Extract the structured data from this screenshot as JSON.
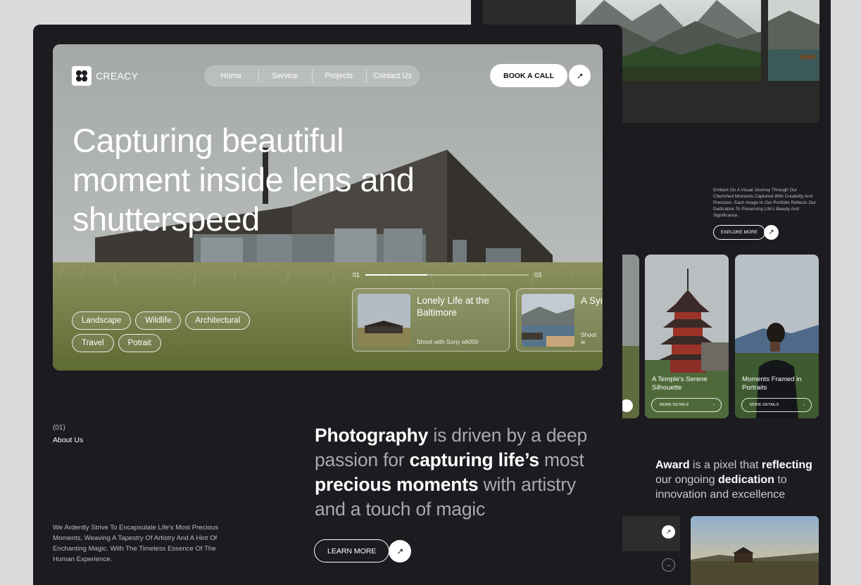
{
  "brand": {
    "name": "CREACY"
  },
  "nav": {
    "items": [
      "Home",
      "Service",
      "Projects",
      "Contact Us"
    ]
  },
  "cta": {
    "book_label": "BOOK A CALL",
    "arrow": "↗"
  },
  "hero": {
    "headline_lines": [
      "Capturing beautiful",
      "moment inside lens and",
      "shutterspeed"
    ],
    "tags": [
      "Landscape",
      "Wildlife",
      "Architectural",
      "Travel",
      "Potrait"
    ],
    "progress": {
      "start": "01",
      "end": "03",
      "fraction": 0.38
    },
    "slides": [
      {
        "title": "Lonely Life at the Baltimore",
        "subtitle": "Shoot with Sony a6000"
      },
      {
        "title": "A Syr Seas",
        "subtitle": "Shoot w"
      }
    ]
  },
  "about": {
    "number": "(01)",
    "label": "About Us",
    "blurb": "We Ardently Strive To Encapsulate Life's Most Precious Moments, Weaving A Tapestry Of Artistry And A Hint Of Enchanting Magic. With The Timeless Essence Of The Human Experience.",
    "statement": {
      "p1": "Photography",
      "p2": " is driven by a deep passion for ",
      "p3": "capturing life’s",
      "p4": " most ",
      "p5": "precious moments",
      "p6": " with artistry and a touch of magic"
    },
    "learn_more": "LEARN MORE"
  },
  "back": {
    "description": "Embark On A Visual Journey Through Our Cherished Moments Captured With Creativity And Precision. Each Image In Our Portfolio Reflects Our Dedication To Preserving Life's Beauty And Significance.",
    "explore": "EXPLORE MORE",
    "tiles": [
      {
        "caption": "A Temple's Serene Silhouette",
        "more": "MORE DETAILS"
      },
      {
        "caption": "Moments Framed in Portraits",
        "more": "MORE DETAILS"
      }
    ],
    "award": {
      "a1": "Award",
      "a2": " is a pixel that ",
      "a3": "reflecting",
      "a4": " our ongoing ",
      "a5": "dedication",
      "a6": " to innovation and excellence"
    }
  },
  "colors": {
    "page_bg": "#dadbdd",
    "card_bg": "#1c1b20",
    "muted_text": "#a9a9ae"
  }
}
